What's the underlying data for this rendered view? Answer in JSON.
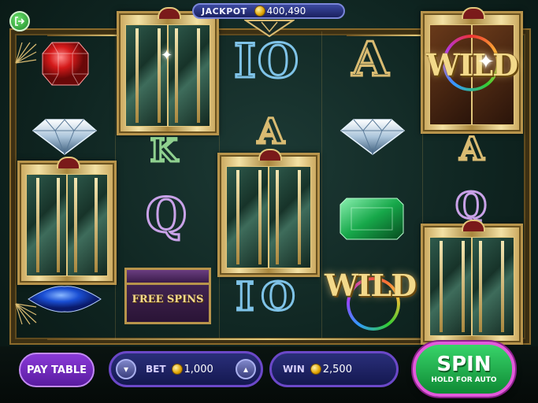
{
  "header": {
    "jackpot_label": "JACKPOT",
    "jackpot_value": "400,490"
  },
  "reels": {
    "letters": {
      "i": "I",
      "o": "O",
      "a": "A",
      "k": "K",
      "q": "Q"
    },
    "wild_label": "WILD",
    "free_spins_label": "FREE SPINS"
  },
  "controls": {
    "pay_table_label": "PAY TABLE",
    "bet_label": "BET",
    "bet_value": "1,000",
    "win_label": "WIN",
    "win_value": "2,500",
    "spin_label": "SPIN",
    "spin_sub_label": "HOLD FOR AUTO"
  },
  "icons": {
    "exit": "exit-icon",
    "coin": "coin-icon",
    "minus": "chevron-down-icon",
    "plus": "chevron-up-icon"
  },
  "colors": {
    "background": "#0f2521",
    "gold": "#d9bb72",
    "spin_green": "#1fa84a",
    "pill_purple": "#6b48c8"
  }
}
